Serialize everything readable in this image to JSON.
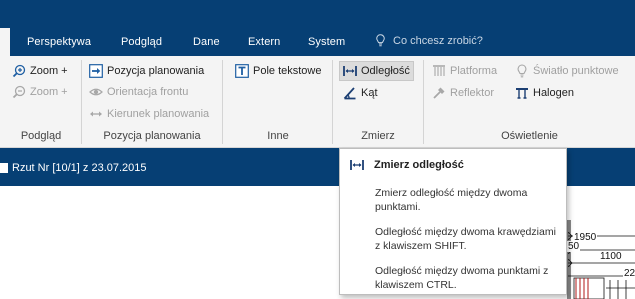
{
  "tabs": {
    "items": [
      "Perspektywa",
      "Podgląd",
      "Dane",
      "Extern",
      "System"
    ],
    "help_placeholder": "Co chcesz zrobić?"
  },
  "ribbon": {
    "podglad": {
      "label": "Podgląd",
      "zoom_in": "Zoom +",
      "zoom_out": "Zoom +"
    },
    "pozycja": {
      "label": "Pozycja planowania",
      "pozycja_planowania": "Pozycja planowania",
      "orientacja_frontu": "Orientacja frontu",
      "kierunek_planowania": "Kierunek planowania"
    },
    "inne": {
      "label": "Inne",
      "pole_tekstowe": "Pole tekstowe"
    },
    "zmierz": {
      "label": "Zmierz",
      "odleglosc": "Odległość",
      "kat": "Kąt"
    },
    "oswietlenie": {
      "label": "Oświetlenie",
      "platforma": "Platforma",
      "reflektor": "Reflektor",
      "swiatlo_punktowe": "Światło punktowe",
      "halogen": "Halogen"
    }
  },
  "document": {
    "title": "Rzut Nr [10/1] z 23.07.2015"
  },
  "drawing": {
    "dims": [
      "1950",
      "50",
      "1100",
      "22"
    ]
  },
  "tooltip": {
    "title": "Zmierz odległość",
    "p1": "Zmierz odległość między dwoma punktami.",
    "p2": "Odległość między dwoma krawędziami z klawiszem SHIFT.",
    "p3": "Odległość między dwoma punktami z klawiszem CTRL."
  },
  "colors": {
    "titlebar": "#063f74",
    "ribbon_bg": "#f4f4f4",
    "accent_icon": "#1f5fa3"
  }
}
